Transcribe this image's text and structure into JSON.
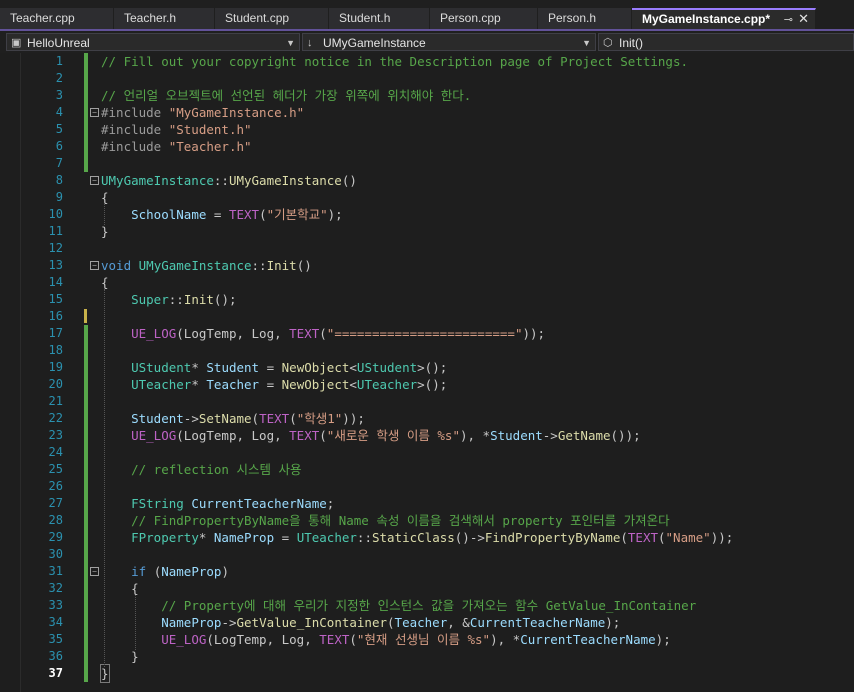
{
  "tabs": [
    {
      "label": "Teacher.cpp"
    },
    {
      "label": "Teacher.h"
    },
    {
      "label": "Student.cpp"
    },
    {
      "label": "Student.h"
    },
    {
      "label": "Person.cpp"
    },
    {
      "label": "Person.h"
    },
    {
      "label": "MyGameInstance.cpp*",
      "active": true
    }
  ],
  "nav": {
    "project": "HelloUnreal",
    "class": "UMyGameInstance",
    "member": "Init()"
  },
  "editor": {
    "current_line": 37,
    "accent": "#9a7dff",
    "lines": [
      [
        [
          "c",
          "// Fill out your copyright notice in the Description page of Project Settings."
        ]
      ],
      [],
      [
        [
          "c",
          "// 언리얼 오브젝트에 선언된 헤더가 가장 위쪽에 위치해야 한다."
        ]
      ],
      [
        [
          "p",
          "#include "
        ],
        [
          "s",
          "\"MyGameInstance.h\""
        ]
      ],
      [
        [
          "p",
          "#include "
        ],
        [
          "s",
          "\"Student.h\""
        ]
      ],
      [
        [
          "p",
          "#include "
        ],
        [
          "s",
          "\"Teacher.h\""
        ]
      ],
      [],
      [
        [
          "t",
          "UMyGameInstance"
        ],
        [
          "b",
          "::"
        ],
        [
          "f",
          "UMyGameInstance"
        ],
        [
          "b",
          "()"
        ]
      ],
      [
        [
          "b",
          "{"
        ]
      ],
      [
        [
          "b",
          "    "
        ],
        [
          "v",
          "SchoolName"
        ],
        [
          "b",
          " = "
        ],
        [
          "m",
          "TEXT"
        ],
        [
          "b",
          "("
        ],
        [
          "s",
          "\"기본학교\""
        ],
        [
          "b",
          ");"
        ]
      ],
      [
        [
          "b",
          "}"
        ]
      ],
      [],
      [
        [
          "k",
          "void "
        ],
        [
          "t",
          "UMyGameInstance"
        ],
        [
          "b",
          "::"
        ],
        [
          "f",
          "Init"
        ],
        [
          "b",
          "()"
        ]
      ],
      [
        [
          "b",
          "{"
        ]
      ],
      [
        [
          "b",
          "    "
        ],
        [
          "t",
          "Super"
        ],
        [
          "b",
          "::"
        ],
        [
          "f",
          "Init"
        ],
        [
          "b",
          "();"
        ]
      ],
      [],
      [
        [
          "b",
          "    "
        ],
        [
          "m",
          "UE_LOG"
        ],
        [
          "b",
          "(LogTemp, Log, "
        ],
        [
          "m",
          "TEXT"
        ],
        [
          "b",
          "("
        ],
        [
          "s",
          "\"========================\""
        ],
        [
          "b",
          "));"
        ]
      ],
      [],
      [
        [
          "b",
          "    "
        ],
        [
          "t",
          "UStudent"
        ],
        [
          "b",
          "* "
        ],
        [
          "v",
          "Student"
        ],
        [
          "b",
          " = "
        ],
        [
          "f",
          "NewObject"
        ],
        [
          "b",
          "<"
        ],
        [
          "t",
          "UStudent"
        ],
        [
          "b",
          ">();"
        ]
      ],
      [
        [
          "b",
          "    "
        ],
        [
          "t",
          "UTeacher"
        ],
        [
          "b",
          "* "
        ],
        [
          "v",
          "Teacher"
        ],
        [
          "b",
          " = "
        ],
        [
          "f",
          "NewObject"
        ],
        [
          "b",
          "<"
        ],
        [
          "t",
          "UTeacher"
        ],
        [
          "b",
          ">();"
        ]
      ],
      [],
      [
        [
          "b",
          "    "
        ],
        [
          "v",
          "Student"
        ],
        [
          "b",
          "->"
        ],
        [
          "f",
          "SetName"
        ],
        [
          "b",
          "("
        ],
        [
          "m",
          "TEXT"
        ],
        [
          "b",
          "("
        ],
        [
          "s",
          "\"학생1\""
        ],
        [
          "b",
          "));"
        ]
      ],
      [
        [
          "b",
          "    "
        ],
        [
          "m",
          "UE_LOG"
        ],
        [
          "b",
          "(LogTemp, Log, "
        ],
        [
          "m",
          "TEXT"
        ],
        [
          "b",
          "("
        ],
        [
          "s",
          "\"새로운 학생 이름 %s\""
        ],
        [
          "b",
          "), *"
        ],
        [
          "v",
          "Student"
        ],
        [
          "b",
          "->"
        ],
        [
          "f",
          "GetName"
        ],
        [
          "b",
          "());"
        ]
      ],
      [],
      [
        [
          "b",
          "    "
        ],
        [
          "c",
          "// reflection 시스템 사용"
        ]
      ],
      [],
      [
        [
          "b",
          "    "
        ],
        [
          "t",
          "FString"
        ],
        [
          "b",
          " "
        ],
        [
          "v",
          "CurrentTeacherName"
        ],
        [
          "b",
          ";"
        ]
      ],
      [
        [
          "b",
          "    "
        ],
        [
          "c",
          "// FindPropertyByName을 통해 Name 속성 이름을 검색해서 property 포인터를 가져온다"
        ]
      ],
      [
        [
          "b",
          "    "
        ],
        [
          "t",
          "FProperty"
        ],
        [
          "b",
          "* "
        ],
        [
          "v",
          "NameProp"
        ],
        [
          "b",
          " = "
        ],
        [
          "t",
          "UTeacher"
        ],
        [
          "b",
          "::"
        ],
        [
          "f",
          "StaticClass"
        ],
        [
          "b",
          "()->"
        ],
        [
          "f",
          "FindPropertyByName"
        ],
        [
          "b",
          "("
        ],
        [
          "m",
          "TEXT"
        ],
        [
          "b",
          "("
        ],
        [
          "s",
          "\"Name\""
        ],
        [
          "b",
          "));"
        ]
      ],
      [],
      [
        [
          "b",
          "    "
        ],
        [
          "k",
          "if"
        ],
        [
          "b",
          " ("
        ],
        [
          "v",
          "NameProp"
        ],
        [
          "b",
          ")"
        ]
      ],
      [
        [
          "b",
          "    {"
        ]
      ],
      [
        [
          "b",
          "        "
        ],
        [
          "c",
          "// Property에 대해 우리가 지정한 인스턴스 값을 가져오는 함수 GetValue_InContainer"
        ]
      ],
      [
        [
          "b",
          "        "
        ],
        [
          "v",
          "NameProp"
        ],
        [
          "b",
          "->"
        ],
        [
          "f",
          "GetValue_InContainer"
        ],
        [
          "b",
          "("
        ],
        [
          "v",
          "Teacher"
        ],
        [
          "b",
          ", &"
        ],
        [
          "v",
          "CurrentTeacherName"
        ],
        [
          "b",
          ");"
        ]
      ],
      [
        [
          "b",
          "        "
        ],
        [
          "m",
          "UE_LOG"
        ],
        [
          "b",
          "(LogTemp, Log, "
        ],
        [
          "m",
          "TEXT"
        ],
        [
          "b",
          "("
        ],
        [
          "s",
          "\"현재 선생님 이름 %s\""
        ],
        [
          "b",
          "), *"
        ],
        [
          "v",
          "CurrentTeacherName"
        ],
        [
          "b",
          ");"
        ]
      ],
      [
        [
          "b",
          "    }"
        ]
      ],
      [
        [
          "b",
          "}"
        ]
      ]
    ]
  }
}
